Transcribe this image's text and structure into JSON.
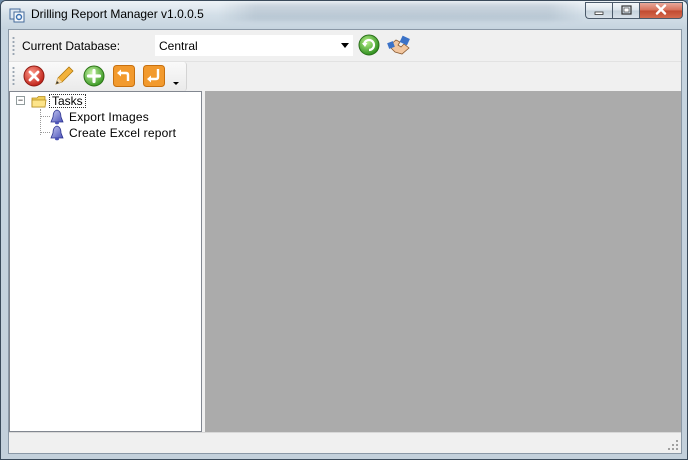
{
  "window": {
    "title": "Drilling Report Manager v1.0.0.5",
    "caption_buttons": [
      "minimize-icon",
      "maximize-icon",
      "close-icon"
    ]
  },
  "database_bar": {
    "label": "Current Database:",
    "selected": "Central",
    "actions": [
      "refresh-icon",
      "connect-icon"
    ]
  },
  "toolbar": {
    "buttons": [
      {
        "name": "delete-button",
        "icon": "delete-icon"
      },
      {
        "name": "edit-button",
        "icon": "pencil-icon"
      },
      {
        "name": "add-button",
        "icon": "plus-icon"
      },
      {
        "name": "undo-button",
        "icon": "undo-arrow-icon"
      },
      {
        "name": "enter-button",
        "icon": "return-arrow-icon"
      }
    ]
  },
  "tree": {
    "root": "Tasks",
    "children": [
      "Export Images",
      "Create Excel report"
    ]
  },
  "colors": {
    "content_bg": "#ababab",
    "accent_orange": "#f0a030",
    "accent_green": "#4caf3a",
    "accent_red": "#d23a2a"
  }
}
